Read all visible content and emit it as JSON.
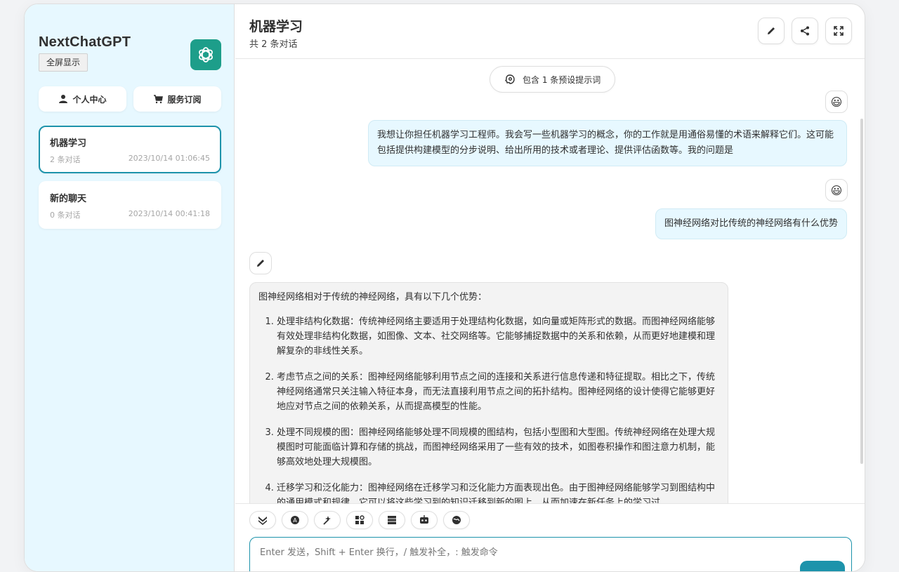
{
  "sidebar": {
    "brand": "NextChatGPT",
    "fullscreen_label": "全屏显示",
    "buttons": [
      {
        "label": "个人中心",
        "icon": "user-icon"
      },
      {
        "label": "服务订阅",
        "icon": "cart-icon"
      }
    ],
    "chats": [
      {
        "title": "机器学习",
        "count": "2 条对话",
        "time": "2023/10/14 01:06:45",
        "active": true
      },
      {
        "title": "新的聊天",
        "count": "0 条对话",
        "time": "2023/10/14 00:41:18",
        "active": false
      }
    ]
  },
  "header": {
    "title": "机器学习",
    "subtitle": "共 2 条对话",
    "icons": [
      "edit-icon",
      "share-icon",
      "fullscreen-icon"
    ]
  },
  "messages": {
    "prompt_pill": "包含 1 条预设提示词",
    "user1": "我想让你担任机器学习工程师。我会写一些机器学习的概念，你的工作就是用通俗易懂的术语来解释它们。这可能包括提供构建模型的分步说明、给出所用的技术或者理论、提供评估函数等。我的问题是",
    "user2": "图神经网络对比传统的神经网络有什么优势",
    "bot_intro": "图神经网络相对于传统的神经网络，具有以下几个优势：",
    "bot_points": [
      "处理非结构化数据：传统神经网络主要适用于处理结构化数据，如向量或矩阵形式的数据。而图神经网络能够有效处理非结构化数据，如图像、文本、社交网络等。它能够捕捉数据中的关系和依赖，从而更好地建模和理解复杂的非线性关系。",
      "考虑节点之间的关系：图神经网络能够利用节点之间的连接和关系进行信息传递和特征提取。相比之下，传统神经网络通常只关注输入特征本身，而无法直接利用节点之间的拓扑结构。图神经网络的设计使得它能够更好地应对节点之间的依赖关系，从而提高模型的性能。",
      "处理不同规模的图：图神经网络能够处理不同规模的图结构，包括小型图和大型图。传统神经网络在处理大规模图时可能面临计算和存储的挑战，而图神经网络采用了一些有效的技术，如图卷积操作和图注意力机制，能够高效地处理大规模图。",
      "迁移学习和泛化能力：图神经网络在迁移学习和泛化能力方面表现出色。由于图神经网络能够学习到图结构中的通用模式和规律，它可以将这些学习到的知识迁移到新的图上，从而加速在新任务上的学习过"
    ]
  },
  "composer": {
    "placeholder": "Enter 发送，Shift + Enter 换行，/ 触发补全，: 触发命令",
    "tools": [
      "scroll-down-icon",
      "theme-icon",
      "prompt-icon",
      "mask-icon",
      "clear-icon",
      "robot-icon",
      "plugin-icon"
    ]
  },
  "colors": {
    "accent": "#1d93ab",
    "sidebar_bg": "#e7f8ff",
    "logo_bg": "#1d9e8a"
  }
}
